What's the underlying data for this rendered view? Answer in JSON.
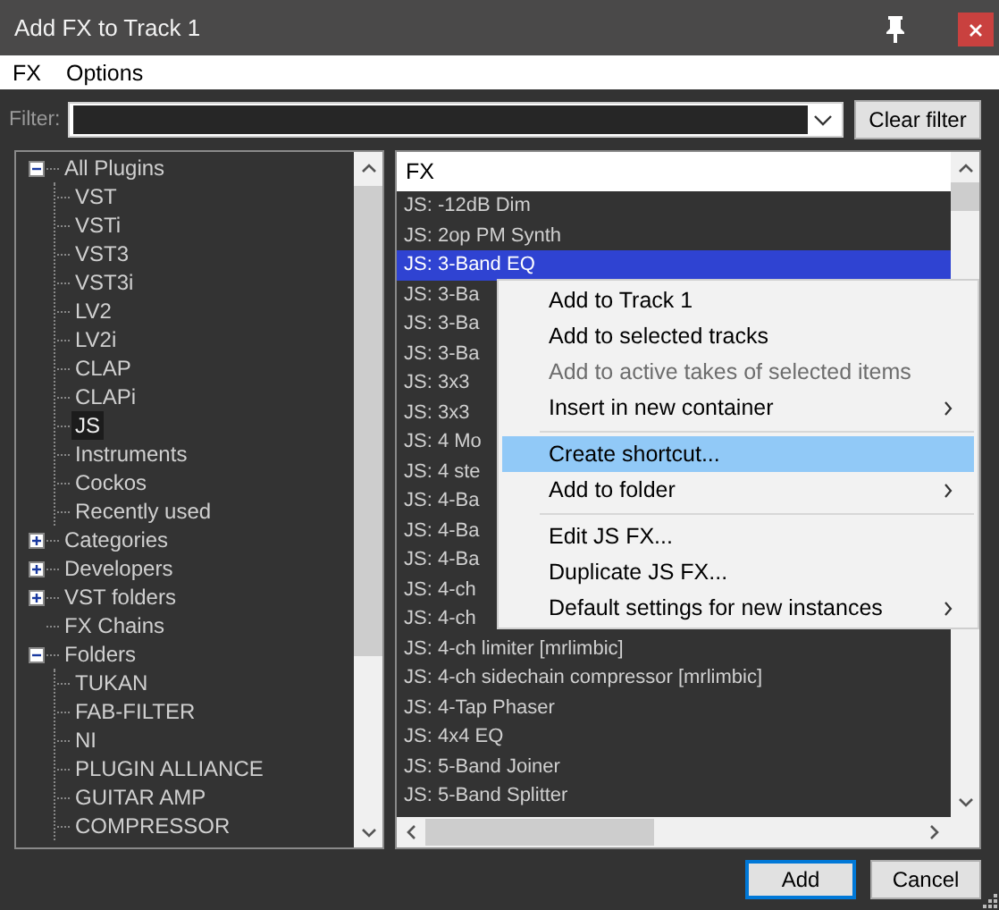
{
  "window": {
    "title": "Add FX to Track 1"
  },
  "menu_bar": [
    "FX",
    "Options"
  ],
  "filter": {
    "label": "Filter:",
    "clear_button": "Clear filter"
  },
  "tree": [
    {
      "label": "All Plugins",
      "expanded": true,
      "selected": false,
      "children": [
        {
          "label": "VST",
          "selected": false
        },
        {
          "label": "VSTi",
          "selected": false
        },
        {
          "label": "VST3",
          "selected": false
        },
        {
          "label": "VST3i",
          "selected": false
        },
        {
          "label": "LV2",
          "selected": false
        },
        {
          "label": "LV2i",
          "selected": false
        },
        {
          "label": "CLAP",
          "selected": false
        },
        {
          "label": "CLAPi",
          "selected": false
        },
        {
          "label": "JS",
          "selected": true
        },
        {
          "label": "Instruments",
          "selected": false
        },
        {
          "label": "Cockos",
          "selected": false
        },
        {
          "label": "Recently used",
          "selected": false
        }
      ]
    },
    {
      "label": "Categories",
      "expanded": false,
      "selected": false
    },
    {
      "label": "Developers",
      "expanded": false,
      "selected": false
    },
    {
      "label": "VST folders",
      "expanded": false,
      "selected": false
    },
    {
      "label": "FX Chains",
      "selected": false
    },
    {
      "label": "Folders",
      "expanded": true,
      "selected": false,
      "children": [
        {
          "label": "TUKAN",
          "selected": false
        },
        {
          "label": "FAB-FILTER",
          "selected": false
        },
        {
          "label": "NI",
          "selected": false
        },
        {
          "label": "PLUGIN ALLIANCE",
          "selected": false
        },
        {
          "label": "GUITAR AMP",
          "selected": false
        },
        {
          "label": "COMPRESSOR",
          "selected": false
        }
      ]
    }
  ],
  "list": {
    "header": "FX",
    "rows": [
      {
        "label": "JS: -12dB Dim",
        "selected": false
      },
      {
        "label": "JS: 2op PM Synth",
        "selected": false
      },
      {
        "label": "JS: 3-Band EQ",
        "selected": true
      },
      {
        "label": "JS: 3-Ba",
        "selected": false
      },
      {
        "label": "JS: 3-Ba",
        "selected": false
      },
      {
        "label": "JS: 3-Ba",
        "selected": false
      },
      {
        "label": "JS: 3x3",
        "selected": false
      },
      {
        "label": "JS: 3x3",
        "selected": false
      },
      {
        "label": "JS: 4 Mo",
        "selected": false
      },
      {
        "label": "JS: 4 ste",
        "selected": false
      },
      {
        "label": "JS: 4-Ba",
        "selected": false
      },
      {
        "label": "JS: 4-Ba",
        "selected": false
      },
      {
        "label": "JS: 4-Ba",
        "selected": false
      },
      {
        "label": "JS: 4-ch",
        "selected": false
      },
      {
        "label": "JS: 4-ch",
        "selected": false
      },
      {
        "label": "JS: 4-ch limiter [mrlimbic]",
        "selected": false
      },
      {
        "label": "JS: 4-ch sidechain compressor [mrlimbic]",
        "selected": false
      },
      {
        "label": "JS: 4-Tap Phaser",
        "selected": false
      },
      {
        "label": "JS: 4x4 EQ",
        "selected": false
      },
      {
        "label": "JS: 5-Band Joiner",
        "selected": false
      },
      {
        "label": "JS: 5-Band Splitter",
        "selected": false
      }
    ]
  },
  "context_menu": [
    {
      "kind": "item",
      "label": "Add to Track 1",
      "disabled": false,
      "submenu": false,
      "selected": false
    },
    {
      "kind": "item",
      "label": "Add to selected tracks",
      "disabled": false,
      "submenu": false,
      "selected": false
    },
    {
      "kind": "item",
      "label": "Add to active takes of selected items",
      "disabled": true,
      "submenu": false,
      "selected": false
    },
    {
      "kind": "item",
      "label": "Insert in new container",
      "disabled": false,
      "submenu": true,
      "selected": false
    },
    {
      "kind": "separator"
    },
    {
      "kind": "item",
      "label": "Create shortcut...",
      "disabled": false,
      "submenu": false,
      "selected": true
    },
    {
      "kind": "item",
      "label": "Add to folder",
      "disabled": false,
      "submenu": true,
      "selected": false
    },
    {
      "kind": "separator"
    },
    {
      "kind": "item",
      "label": "Edit JS FX...",
      "disabled": false,
      "submenu": false,
      "selected": false
    },
    {
      "kind": "item",
      "label": "Duplicate JS FX...",
      "disabled": false,
      "submenu": false,
      "selected": false
    },
    {
      "kind": "item",
      "label": "Default settings for new instances",
      "disabled": false,
      "submenu": true,
      "selected": false
    }
  ],
  "buttons": [
    {
      "label": "Add",
      "focused": true
    },
    {
      "label": "Cancel",
      "focused": false
    }
  ]
}
